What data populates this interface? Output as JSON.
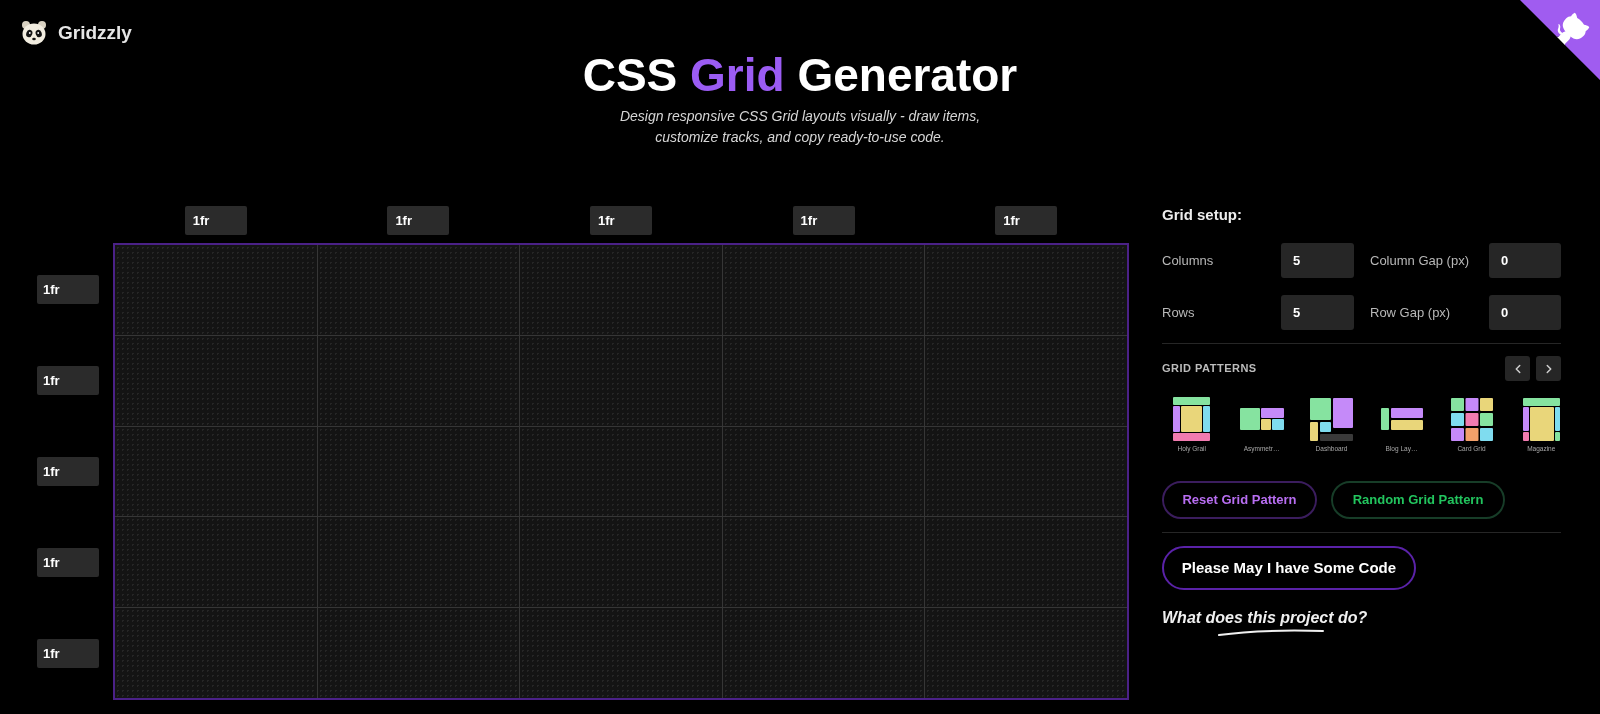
{
  "brand": {
    "name": "Gridzzly"
  },
  "hero": {
    "title": [
      {
        "text": "CSS",
        "highlight": false
      },
      {
        "text": "Grid",
        "highlight": true
      },
      {
        "text": "Generator",
        "highlight": false
      }
    ],
    "subtitle": "Design responsive CSS Grid layouts visually - draw items, customize tracks, and copy ready-to-use code."
  },
  "grid": {
    "column_tracks": [
      "1fr",
      "1fr",
      "1fr",
      "1fr",
      "1fr"
    ],
    "row_tracks": [
      "1fr",
      "1fr",
      "1fr",
      "1fr",
      "1fr"
    ]
  },
  "setup": {
    "heading": "Grid setup:",
    "fields": [
      {
        "label": "Columns",
        "value": "5"
      },
      {
        "label": "Column Gap (px)",
        "value": "0"
      },
      {
        "label": "Rows",
        "value": "5"
      },
      {
        "label": "Row Gap (px)",
        "value": "0"
      }
    ]
  },
  "patterns": {
    "heading": "GRID PATTERNS",
    "items": [
      {
        "label": "Holy Grail",
        "kind": "holy"
      },
      {
        "label": "Asymmetr…",
        "kind": "asymmetric"
      },
      {
        "label": "Dashboard",
        "kind": "dashboard"
      },
      {
        "label": "Blog Lay…",
        "kind": "blog"
      },
      {
        "label": "Card Grid",
        "kind": "cards"
      },
      {
        "label": "Magazine",
        "kind": "magazine"
      }
    ]
  },
  "actions": [
    {
      "label": "Reset Grid Pattern",
      "kind": "reset"
    },
    {
      "label": "Random Grid Pattern",
      "kind": "random"
    }
  ],
  "code_button": "Please May I have Some Code",
  "about_link": "What does this project do?"
}
